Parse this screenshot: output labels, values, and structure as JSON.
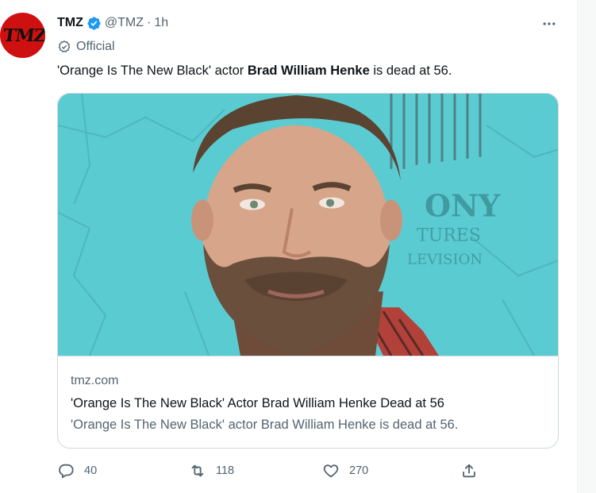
{
  "tweet": {
    "author": {
      "name": "TMZ",
      "handle": "@TMZ",
      "separator": "·",
      "time": "1h",
      "avatar_text": "TMZ",
      "label": "Official"
    },
    "text": {
      "before": "'Orange Is The New Black' actor ",
      "bold": "Brad William Henke",
      "after": " is dead at 56."
    },
    "card": {
      "domain": "tmz.com",
      "title": "'Orange Is The New Black' Actor Brad William Henke Dead at 56",
      "description": "'Orange Is The New Black' actor Brad William Henke is dead at 56.",
      "backdrop_text": [
        "ONY",
        "TURES",
        "LEVISION"
      ]
    },
    "actions": {
      "replies": "40",
      "retweets": "118",
      "likes": "270"
    }
  },
  "colors": {
    "verified": "#1d9bf0",
    "secondary_text": "#536471",
    "avatar_bg": "#cf1010",
    "backdrop": "#52c7cf"
  },
  "icons": [
    "verified-badge-icon",
    "official-check-icon",
    "more-options-icon",
    "reply-icon",
    "retweet-icon",
    "like-icon",
    "share-icon"
  ]
}
